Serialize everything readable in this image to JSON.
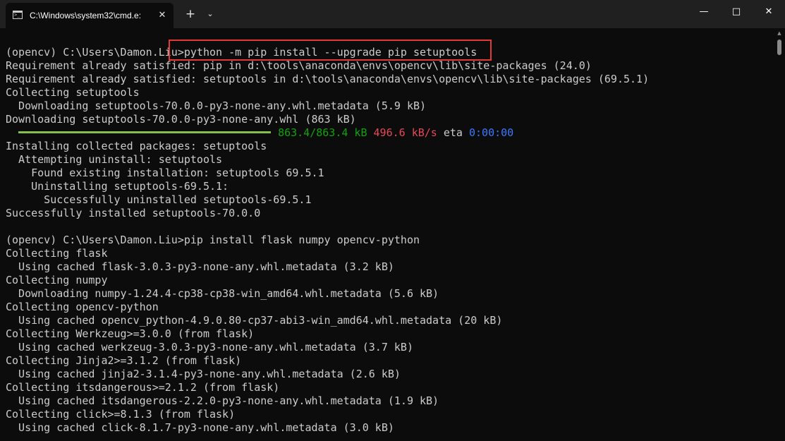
{
  "window": {
    "tab_title": "C:\\Windows\\system32\\cmd.e:",
    "icons": {
      "tab": "cmd-icon",
      "close_tab": "close-icon",
      "new_tab": "plus-icon",
      "dropdown": "chevron-down-icon",
      "minimize": "minimize-icon",
      "maximize": "maximize-icon",
      "close_window": "close-icon"
    },
    "glyphs": {
      "close_tab": "✕",
      "new_tab": "+",
      "dropdown": "⌄",
      "minimize": "—",
      "maximize": "□",
      "close_window": "✕",
      "scroll_up": "▲"
    }
  },
  "terminal": {
    "lines": [
      "(opencv) C:\\Users\\Damon.Liu>python -m pip install --upgrade pip setuptools",
      "Requirement already satisfied: pip in d:\\tools\\anaconda\\envs\\opencv\\lib\\site-packages (24.0)",
      "Requirement already satisfied: setuptools in d:\\tools\\anaconda\\envs\\opencv\\lib\\site-packages (69.5.1)",
      "Collecting setuptools",
      "  Downloading setuptools-70.0.0-py3-none-any.whl.metadata (5.9 kB)",
      "Downloading setuptools-70.0.0-py3-none-any.whl (863 kB)",
      "Installing collected packages: setuptools",
      "  Attempting uninstall: setuptools",
      "    Found existing installation: setuptools 69.5.1",
      "    Uninstalling setuptools-69.5.1:",
      "      Successfully uninstalled setuptools-69.5.1",
      "Successfully installed setuptools-70.0.0",
      "",
      "(opencv) C:\\Users\\Damon.Liu>pip install flask numpy opencv-python",
      "Collecting flask",
      "  Using cached flask-3.0.3-py3-none-any.whl.metadata (3.2 kB)",
      "Collecting numpy",
      "  Downloading numpy-1.24.4-cp38-cp38-win_amd64.whl.metadata (5.6 kB)",
      "Collecting opencv-python",
      "  Using cached opencv_python-4.9.0.80-cp37-abi3-win_amd64.whl.metadata (20 kB)",
      "Collecting Werkzeug>=3.0.0 (from flask)",
      "  Using cached werkzeug-3.0.3-py3-none-any.whl.metadata (3.7 kB)",
      "Collecting Jinja2>=3.1.2 (from flask)",
      "  Using cached jinja2-3.1.4-py3-none-any.whl.metadata (2.6 kB)",
      "Collecting itsdangerous>=2.1.2 (from flask)",
      "  Using cached itsdangerous-2.2.0-py3-none-any.whl.metadata (1.9 kB)",
      "Collecting click>=8.1.3 (from flask)",
      "  Using cached click-8.1.7-py3-none-any.whl.metadata (3.0 kB)"
    ],
    "progress": {
      "fraction": 1.0,
      "size": "863.4/863.4 kB",
      "speed": "496.6 kB/s",
      "eta_label": "eta",
      "eta": "0:00:00"
    },
    "highlighted_command": "python -m pip install --upgrade pip setuptools"
  },
  "colors": {
    "background": "#0c0c0c",
    "text": "#cccccc",
    "progress_bar": "#86c04a",
    "progress_size": "#13a10e",
    "progress_speed": "#e74856",
    "progress_eta": "#3b78ff",
    "highlight_border": "#e53935"
  }
}
